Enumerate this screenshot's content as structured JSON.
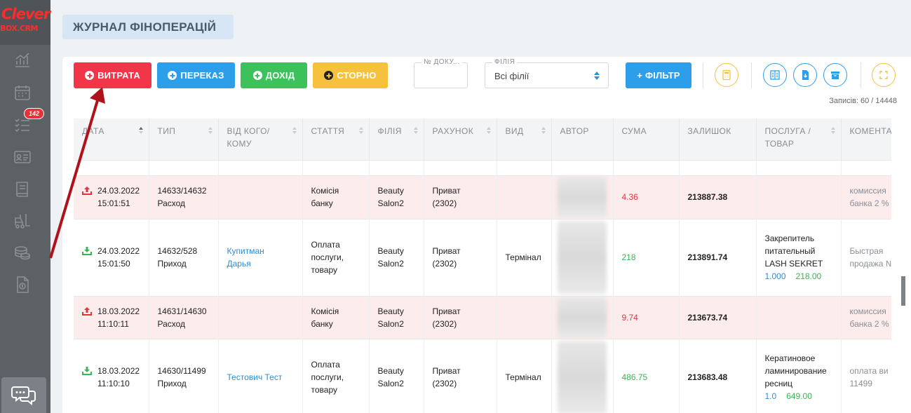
{
  "brand": {
    "line1": "Clever",
    "line2": "BOX.CRM"
  },
  "sidebar": {
    "items": [
      {
        "icon": "analytics-icon"
      },
      {
        "icon": "calendar-icon"
      },
      {
        "icon": "tasks-list-icon",
        "badge": "142"
      },
      {
        "icon": "contact-card-icon"
      },
      {
        "icon": "book-icon"
      },
      {
        "icon": "forklift-icon"
      },
      {
        "icon": "coins-icon"
      },
      {
        "icon": "finance-document-icon"
      }
    ],
    "chat_icon": "chat-bubbles-icon"
  },
  "page": {
    "title": "ЖУРНАЛ ФІНОПЕРАЦІЙ"
  },
  "toolbar": {
    "expense_label": "ВИТРАТА",
    "transfer_label": "ПЕРЕКАЗ",
    "income_label": "ДОХІД",
    "storno_label": "СТОРНО",
    "doc_label": "№ ДОКУ...",
    "doc_value": "",
    "branch_label": "ФІЛІЯ",
    "branch_value": "Всі філії",
    "filter_label": "+ ФІЛЬТР"
  },
  "records": "Записів: 60 / 14448",
  "table": {
    "headers": [
      "ДАТА",
      "ТИП",
      "ВІД КОГО/КОМУ",
      "СТАТТЯ",
      "ФІЛІЯ",
      "РАХУНОК",
      "ВИД",
      "АВТОР",
      "СУМА",
      "ЗАЛИШОК",
      "ПОСЛУГА / ТОВАР",
      "КОМЕНТАР"
    ],
    "rows": [
      {
        "dir": "out",
        "date": "24.03.2022",
        "time": "15:01:51",
        "num": "14633/14632",
        "type": "Расход",
        "party": "",
        "article1": "Комісія",
        "article2": "банку",
        "article3": "",
        "branch1": "Beauty",
        "branch2": "Salon2",
        "acc1": "Приват",
        "acc2": "(2302)",
        "kind": "",
        "sum": "4.36",
        "balance": "213887.38",
        "svc1": "",
        "svc2": "",
        "svc3": "",
        "qty": "",
        "price": "",
        "comment1": "комиссия",
        "comment2": "банка 2 %"
      },
      {
        "dir": "in",
        "date": "24.03.2022",
        "time": "15:01:50",
        "num": "14632/528",
        "type": "Приход",
        "party": "Купитман Дарья",
        "article1": "Оплата",
        "article2": "послуги,",
        "article3": "товару",
        "branch1": "Beauty",
        "branch2": "Salon2",
        "acc1": "Приват",
        "acc2": "(2302)",
        "kind": "Термінал",
        "sum": "218",
        "balance": "213891.74",
        "svc1": "Закрепитель",
        "svc2": "питательный",
        "svc3": "LASH SEKRET",
        "qty": "1.000",
        "price": "218.00",
        "comment1": "Быстрая",
        "comment2": "продажа №"
      },
      {
        "dir": "out",
        "date": "18.03.2022",
        "time": "11:10:11",
        "num": "14631/14630",
        "type": "Расход",
        "party": "",
        "article1": "Комісія",
        "article2": "банку",
        "article3": "",
        "branch1": "Beauty",
        "branch2": "Salon2",
        "acc1": "Приват",
        "acc2": "(2302)",
        "kind": "",
        "sum": "9.74",
        "balance": "213673.74",
        "svc1": "",
        "svc2": "",
        "svc3": "",
        "qty": "",
        "price": "",
        "comment1": "комиссия",
        "comment2": "банка 2 %"
      },
      {
        "dir": "in",
        "date": "18.03.2022",
        "time": "11:10:10",
        "num": "14630/11499",
        "type": "Приход",
        "party": "Тестович Тест",
        "article1": "Оплата",
        "article2": "послуги,",
        "article3": "товару",
        "branch1": "Beauty",
        "branch2": "Salon2",
        "acc1": "Приват",
        "acc2": "(2302)",
        "kind": "Термінал",
        "sum": "486.75",
        "balance": "213683.48",
        "svc1": "Кератиновое",
        "svc2": "ламинирование",
        "svc3": "ресниц",
        "qty": "1.0",
        "price": "649.00",
        "comment1": "оплата ви",
        "comment2": "11499"
      }
    ]
  },
  "colors": {
    "expense": "#f2364a",
    "transfer": "#2d9fea",
    "income": "#3cc15b",
    "storno": "#f6c23e",
    "annotation_arrow": "#b0121b"
  }
}
